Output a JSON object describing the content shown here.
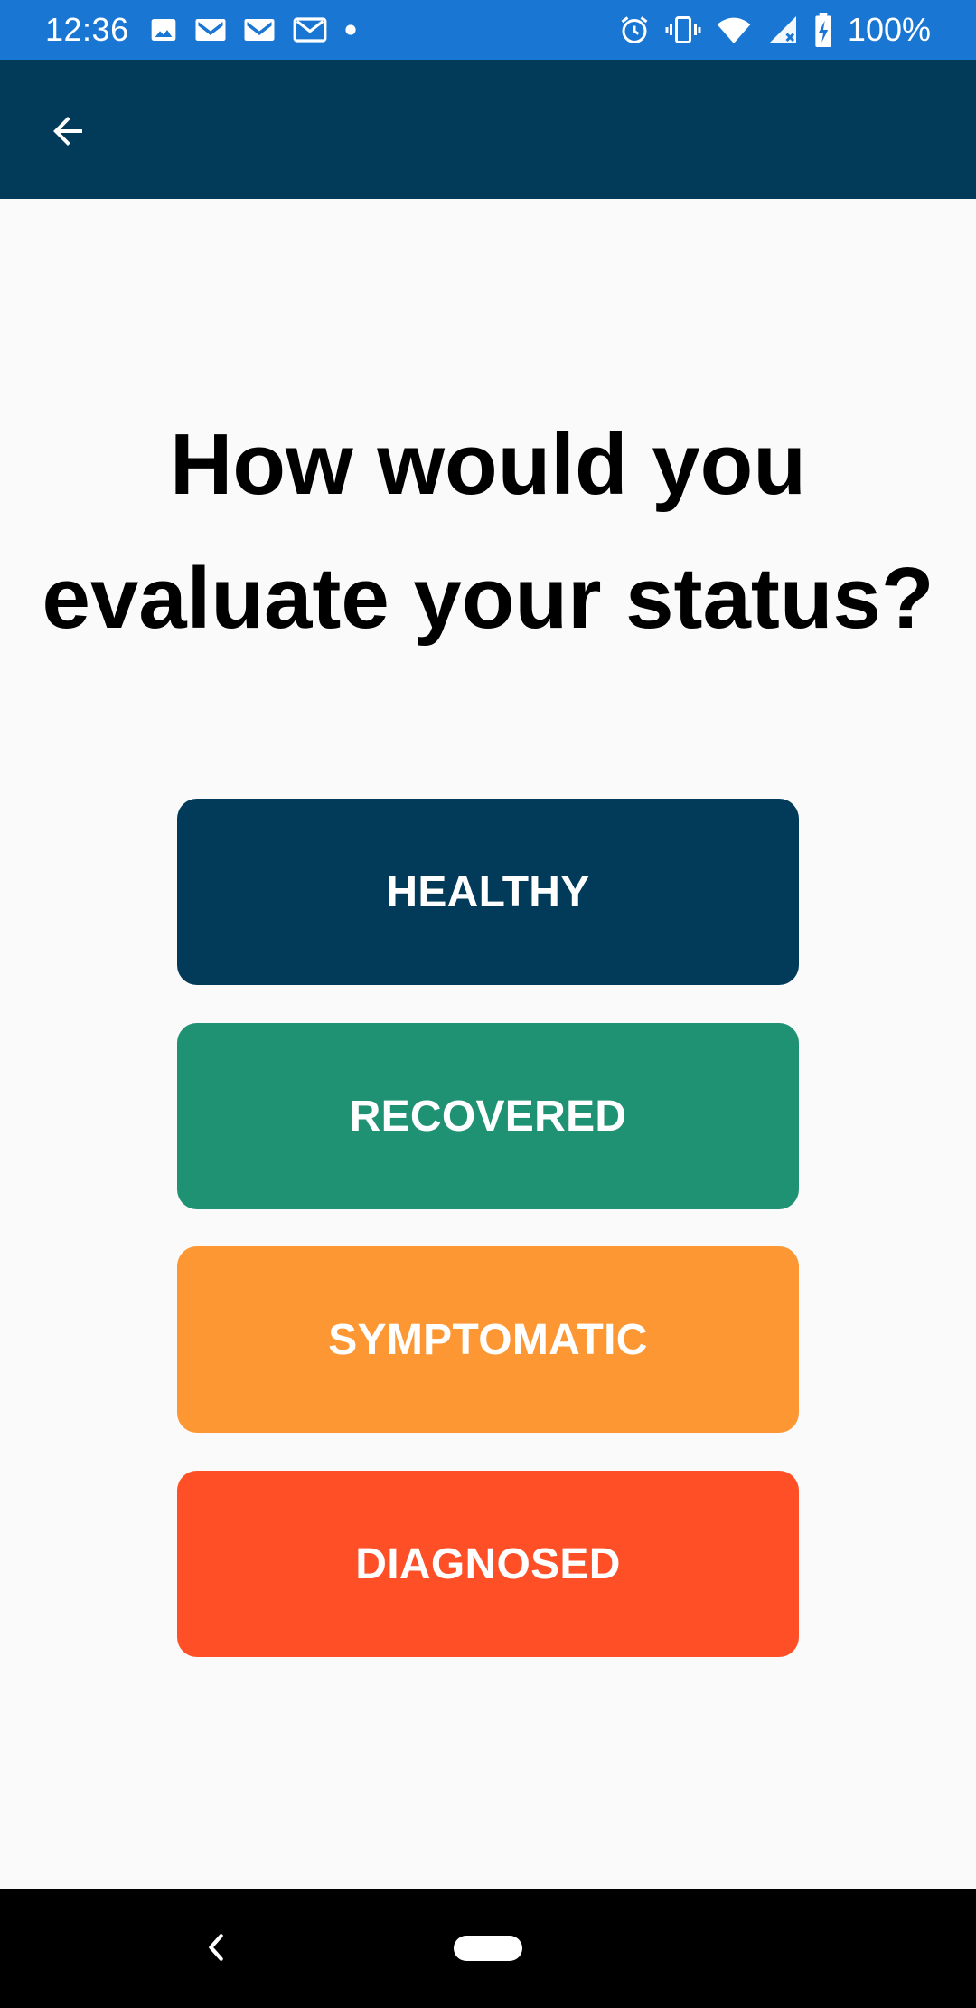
{
  "status_bar": {
    "time": "12:36",
    "battery": "100%",
    "bg_color": "#1976d2",
    "left_icons": [
      "image-icon",
      "gmail-icon",
      "gmail-icon",
      "gmail-outline-icon",
      "dot-icon"
    ],
    "right_icons": [
      "alarm-icon",
      "vibrate-icon",
      "wifi-icon",
      "signal-icon",
      "battery-charging-icon"
    ]
  },
  "app_bar": {
    "bg_color": "#023b5a",
    "back_icon": "arrow-left-icon"
  },
  "main": {
    "title": "How would you evaluate your status?",
    "options": [
      {
        "label": "HEALTHY",
        "color": "#023b5a"
      },
      {
        "label": "RECOVERED",
        "color": "#209274"
      },
      {
        "label": "SYMPTOMATIC",
        "color": "#fc9733"
      },
      {
        "label": "DIAGNOSED",
        "color": "#fe4f27"
      }
    ]
  },
  "nav_bar": {
    "back_icon": "chevron-left-icon",
    "home_icon": "home-pill-icon"
  }
}
